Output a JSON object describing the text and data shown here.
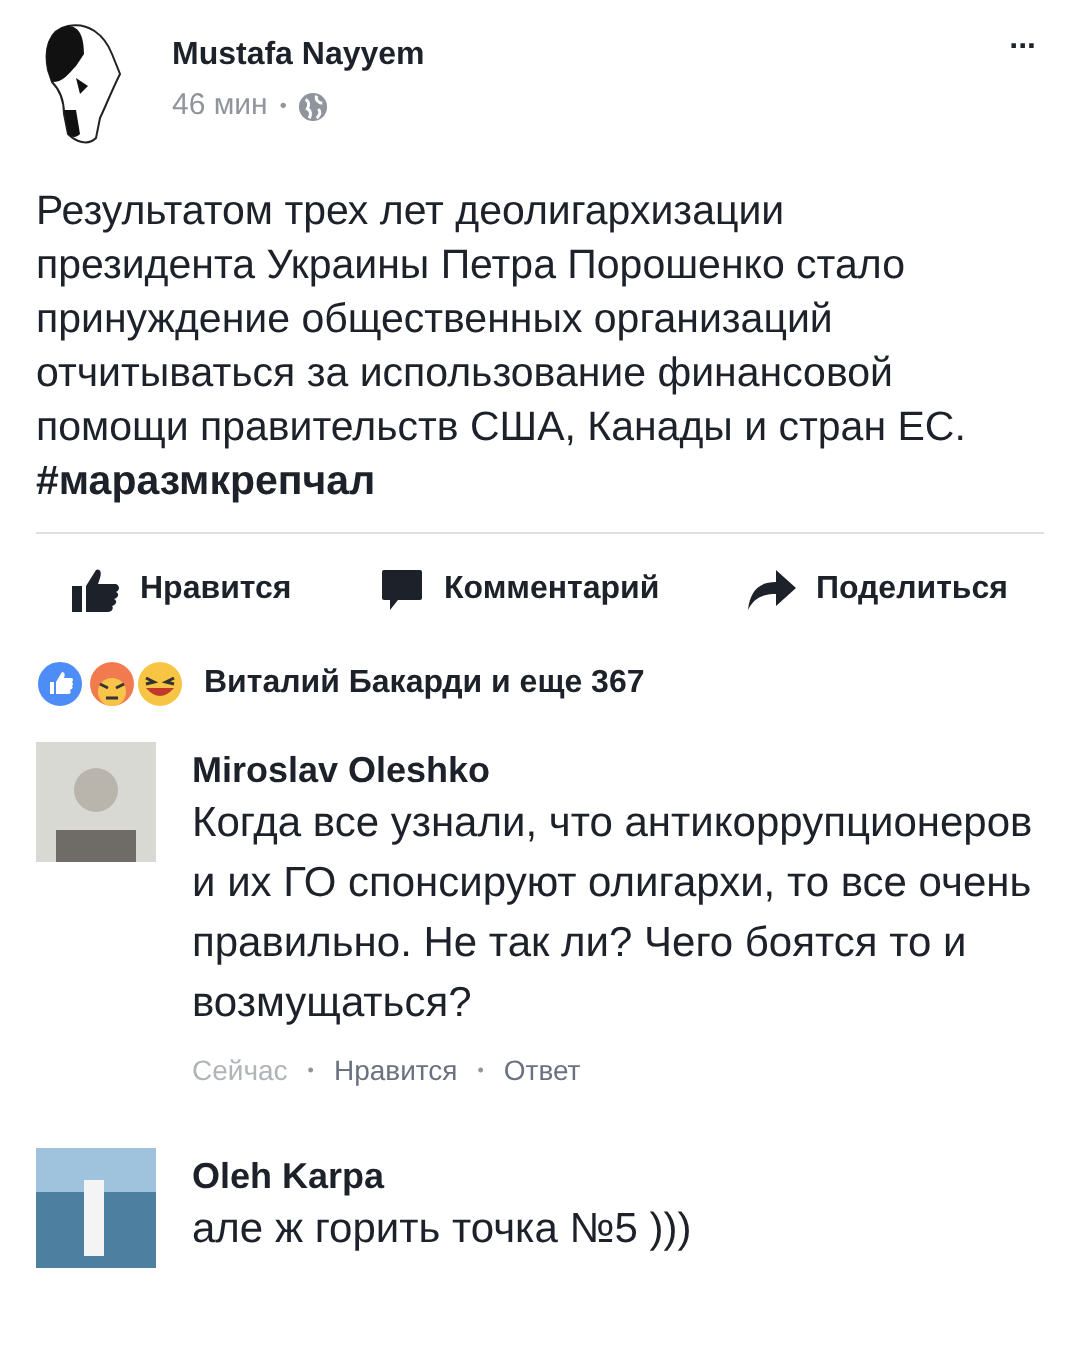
{
  "post": {
    "author": "Mustafa Nayyem",
    "time": "46 мин",
    "separator": "•",
    "text": "Результатом трех лет деолигархизации президента Украины Петра Порошенко стало принуждение общественных организаций отчитываться за использование финансовой помощи правительств США, Канады и стран ЕС.",
    "hashtag": "#маразмкрепчал",
    "more": "..."
  },
  "actions": [
    {
      "kind": "like",
      "label": "Нравится"
    },
    {
      "kind": "comment",
      "label": "Комментарий"
    },
    {
      "kind": "share",
      "label": "Поделиться"
    }
  ],
  "reactions": {
    "text": "Виталий Бакарди и еще 367"
  },
  "comments": [
    {
      "author": "Miroslav Oleshko",
      "text": "Когда все узнали, что антикоррупционеров и их ГО спонсируют олигархи, то все очень правильно. Не так ли? Чего боятся то и возмущаться?",
      "time": "Сейчас",
      "like": "Нравится",
      "reply": "Ответ",
      "separator": "•",
      "kind": "portrait"
    },
    {
      "author": "Oleh Karpa",
      "text": "але ж горить точка №5 )))",
      "kind": "beach"
    }
  ]
}
